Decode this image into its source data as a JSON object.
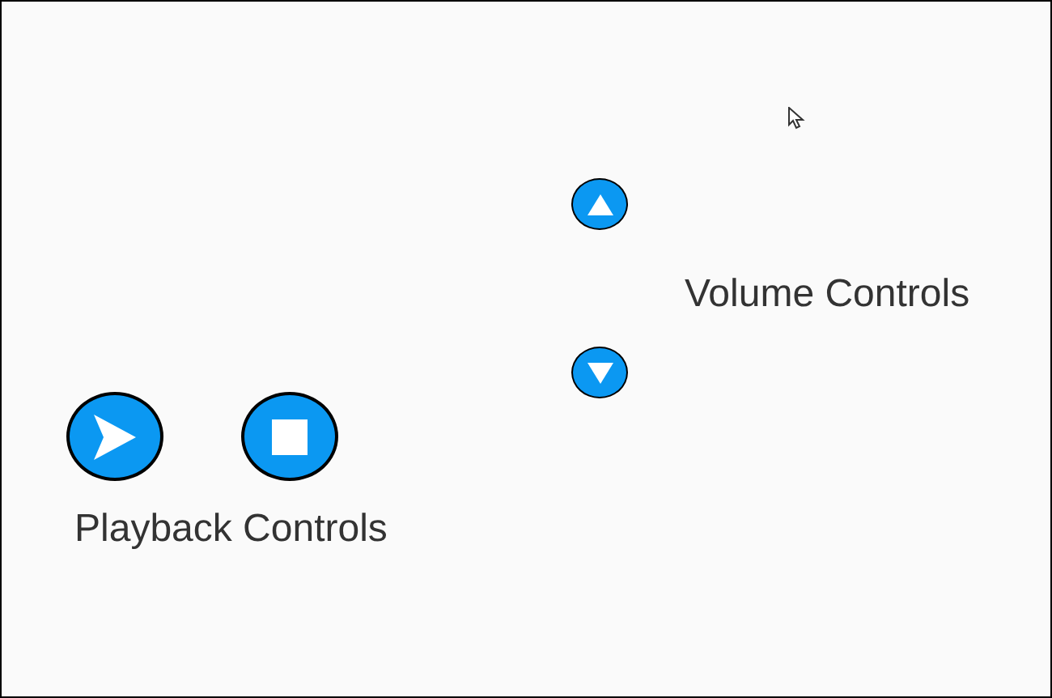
{
  "volume": {
    "label": "Volume Controls",
    "buttons": [
      {
        "kind": "up"
      },
      {
        "kind": "down"
      }
    ]
  },
  "playback": {
    "label": "Playback Controls",
    "buttons": [
      {
        "kind": "play"
      },
      {
        "kind": "stop"
      }
    ]
  }
}
